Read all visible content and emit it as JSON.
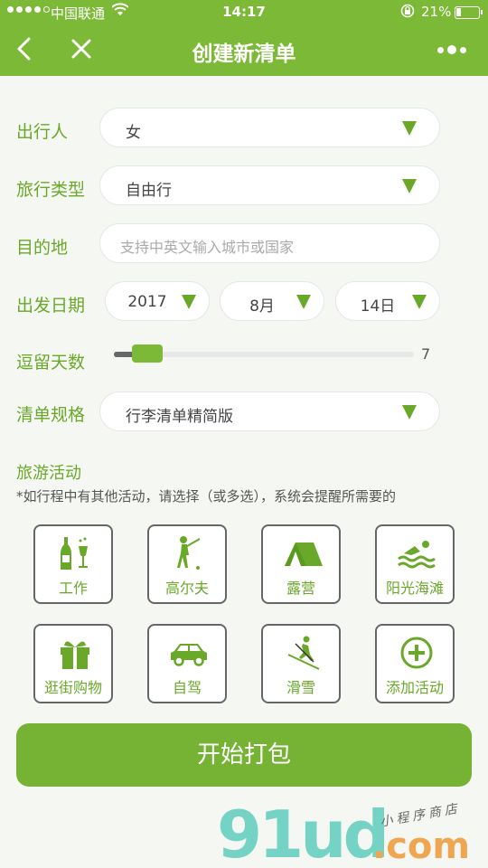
{
  "status_bar": {
    "carrier": "中国联通",
    "time": "14:17",
    "battery": "21%"
  },
  "nav": {
    "title": "创建新清单"
  },
  "form": {
    "traveler": {
      "label": "出行人",
      "value": "女"
    },
    "trip_type": {
      "label": "旅行类型",
      "value": "自由行"
    },
    "destination": {
      "label": "目的地",
      "placeholder": "支持中英文输入城市或国家"
    },
    "date": {
      "label": "出发日期",
      "year": "2017",
      "month": "8月",
      "day": "14日"
    },
    "stay": {
      "label": "逗留天数",
      "value": "7"
    },
    "list_spec": {
      "label": "清单规格",
      "value": "行李清单精简版"
    }
  },
  "activities": {
    "title": "旅游活动",
    "note": "*如行程中有其他活动，请选择（或多选），系统会提醒所需要的",
    "items": [
      {
        "label": "工作",
        "icon": "champagne-icon"
      },
      {
        "label": "高尔夫",
        "icon": "golf-icon"
      },
      {
        "label": "露营",
        "icon": "tent-icon"
      },
      {
        "label": "阳光海滩",
        "icon": "swimming-icon"
      },
      {
        "label": "逛街购物",
        "icon": "gift-icon"
      },
      {
        "label": "自驾",
        "icon": "car-icon"
      },
      {
        "label": "滑雪",
        "icon": "ski-icon"
      },
      {
        "label": "添加活动",
        "icon": "plus-circle-icon"
      }
    ]
  },
  "start_button": "开始打包",
  "watermark": {
    "brand": "91ud",
    "domain": ".com",
    "sub": "小程序商店"
  },
  "colors": {
    "accent": "#7cb937",
    "label": "#6aa82a"
  }
}
